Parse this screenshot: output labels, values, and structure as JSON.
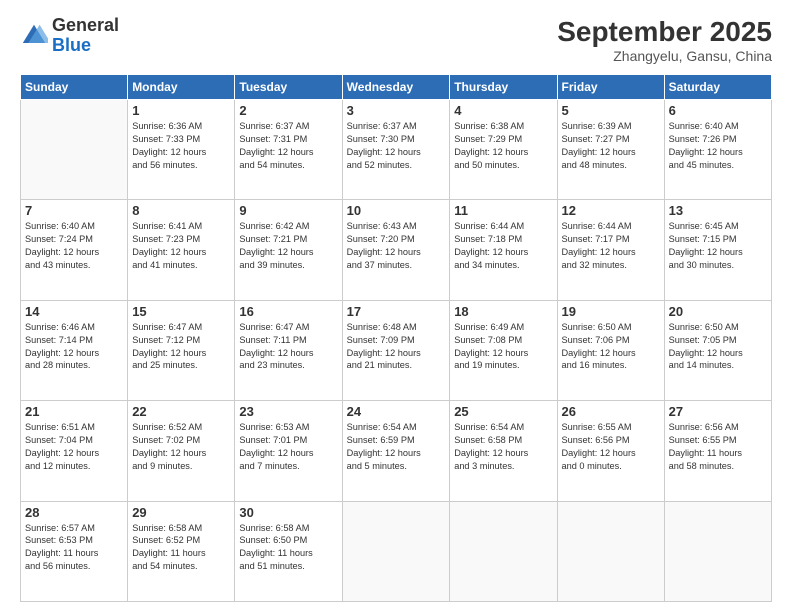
{
  "logo": {
    "general": "General",
    "blue": "Blue"
  },
  "header": {
    "month": "September 2025",
    "location": "Zhangyelu, Gansu, China"
  },
  "weekdays": [
    "Sunday",
    "Monday",
    "Tuesday",
    "Wednesday",
    "Thursday",
    "Friday",
    "Saturday"
  ],
  "weeks": [
    [
      {
        "day": "",
        "info": ""
      },
      {
        "day": "1",
        "info": "Sunrise: 6:36 AM\nSunset: 7:33 PM\nDaylight: 12 hours\nand 56 minutes."
      },
      {
        "day": "2",
        "info": "Sunrise: 6:37 AM\nSunset: 7:31 PM\nDaylight: 12 hours\nand 54 minutes."
      },
      {
        "day": "3",
        "info": "Sunrise: 6:37 AM\nSunset: 7:30 PM\nDaylight: 12 hours\nand 52 minutes."
      },
      {
        "day": "4",
        "info": "Sunrise: 6:38 AM\nSunset: 7:29 PM\nDaylight: 12 hours\nand 50 minutes."
      },
      {
        "day": "5",
        "info": "Sunrise: 6:39 AM\nSunset: 7:27 PM\nDaylight: 12 hours\nand 48 minutes."
      },
      {
        "day": "6",
        "info": "Sunrise: 6:40 AM\nSunset: 7:26 PM\nDaylight: 12 hours\nand 45 minutes."
      }
    ],
    [
      {
        "day": "7",
        "info": "Sunrise: 6:40 AM\nSunset: 7:24 PM\nDaylight: 12 hours\nand 43 minutes."
      },
      {
        "day": "8",
        "info": "Sunrise: 6:41 AM\nSunset: 7:23 PM\nDaylight: 12 hours\nand 41 minutes."
      },
      {
        "day": "9",
        "info": "Sunrise: 6:42 AM\nSunset: 7:21 PM\nDaylight: 12 hours\nand 39 minutes."
      },
      {
        "day": "10",
        "info": "Sunrise: 6:43 AM\nSunset: 7:20 PM\nDaylight: 12 hours\nand 37 minutes."
      },
      {
        "day": "11",
        "info": "Sunrise: 6:44 AM\nSunset: 7:18 PM\nDaylight: 12 hours\nand 34 minutes."
      },
      {
        "day": "12",
        "info": "Sunrise: 6:44 AM\nSunset: 7:17 PM\nDaylight: 12 hours\nand 32 minutes."
      },
      {
        "day": "13",
        "info": "Sunrise: 6:45 AM\nSunset: 7:15 PM\nDaylight: 12 hours\nand 30 minutes."
      }
    ],
    [
      {
        "day": "14",
        "info": "Sunrise: 6:46 AM\nSunset: 7:14 PM\nDaylight: 12 hours\nand 28 minutes."
      },
      {
        "day": "15",
        "info": "Sunrise: 6:47 AM\nSunset: 7:12 PM\nDaylight: 12 hours\nand 25 minutes."
      },
      {
        "day": "16",
        "info": "Sunrise: 6:47 AM\nSunset: 7:11 PM\nDaylight: 12 hours\nand 23 minutes."
      },
      {
        "day": "17",
        "info": "Sunrise: 6:48 AM\nSunset: 7:09 PM\nDaylight: 12 hours\nand 21 minutes."
      },
      {
        "day": "18",
        "info": "Sunrise: 6:49 AM\nSunset: 7:08 PM\nDaylight: 12 hours\nand 19 minutes."
      },
      {
        "day": "19",
        "info": "Sunrise: 6:50 AM\nSunset: 7:06 PM\nDaylight: 12 hours\nand 16 minutes."
      },
      {
        "day": "20",
        "info": "Sunrise: 6:50 AM\nSunset: 7:05 PM\nDaylight: 12 hours\nand 14 minutes."
      }
    ],
    [
      {
        "day": "21",
        "info": "Sunrise: 6:51 AM\nSunset: 7:04 PM\nDaylight: 12 hours\nand 12 minutes."
      },
      {
        "day": "22",
        "info": "Sunrise: 6:52 AM\nSunset: 7:02 PM\nDaylight: 12 hours\nand 9 minutes."
      },
      {
        "day": "23",
        "info": "Sunrise: 6:53 AM\nSunset: 7:01 PM\nDaylight: 12 hours\nand 7 minutes."
      },
      {
        "day": "24",
        "info": "Sunrise: 6:54 AM\nSunset: 6:59 PM\nDaylight: 12 hours\nand 5 minutes."
      },
      {
        "day": "25",
        "info": "Sunrise: 6:54 AM\nSunset: 6:58 PM\nDaylight: 12 hours\nand 3 minutes."
      },
      {
        "day": "26",
        "info": "Sunrise: 6:55 AM\nSunset: 6:56 PM\nDaylight: 12 hours\nand 0 minutes."
      },
      {
        "day": "27",
        "info": "Sunrise: 6:56 AM\nSunset: 6:55 PM\nDaylight: 11 hours\nand 58 minutes."
      }
    ],
    [
      {
        "day": "28",
        "info": "Sunrise: 6:57 AM\nSunset: 6:53 PM\nDaylight: 11 hours\nand 56 minutes."
      },
      {
        "day": "29",
        "info": "Sunrise: 6:58 AM\nSunset: 6:52 PM\nDaylight: 11 hours\nand 54 minutes."
      },
      {
        "day": "30",
        "info": "Sunrise: 6:58 AM\nSunset: 6:50 PM\nDaylight: 11 hours\nand 51 minutes."
      },
      {
        "day": "",
        "info": ""
      },
      {
        "day": "",
        "info": ""
      },
      {
        "day": "",
        "info": ""
      },
      {
        "day": "",
        "info": ""
      }
    ]
  ]
}
